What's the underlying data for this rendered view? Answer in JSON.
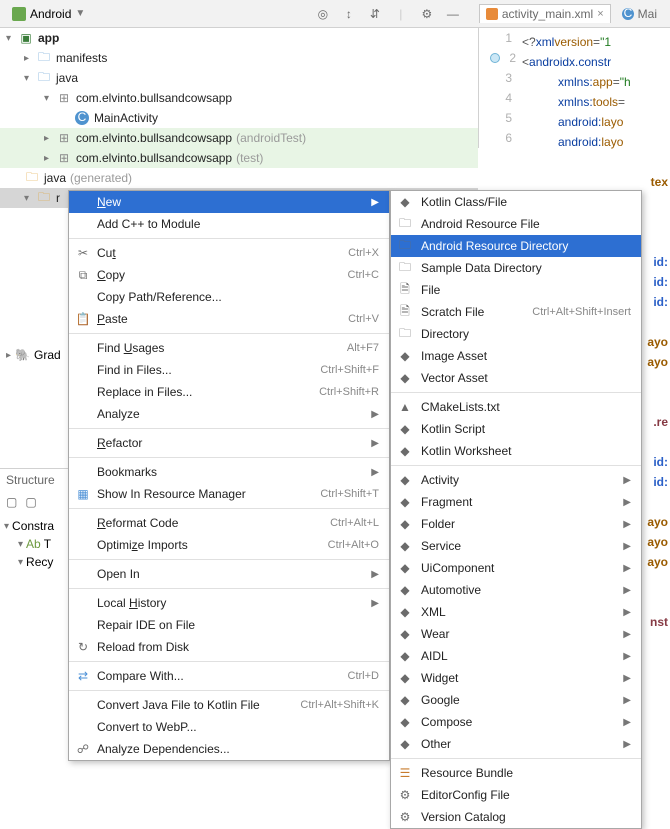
{
  "topbar": {
    "project_label": "Android",
    "tabs": [
      {
        "label": "activity_main.xml",
        "active": true
      },
      {
        "label": "Mai",
        "active": false
      }
    ]
  },
  "tree": {
    "app": "app",
    "manifests": "manifests",
    "java": "java",
    "pkg_main": "com.elvinto.bullsandcowsapp",
    "main_activity": "MainActivity",
    "pkg_android_test": "com.elvinto.bullsandcowsapp",
    "pkg_android_test_suffix": "(androidTest)",
    "pkg_test": "com.elvinto.bullsandcowsapp",
    "pkg_test_suffix": "(test)",
    "java_gen": "java",
    "java_gen_suffix": "(generated)",
    "res": "r",
    "grad": "Grad"
  },
  "structure": {
    "title": "Structure",
    "items": [
      "Constra",
      "T",
      "Recy"
    ]
  },
  "gutter": [
    1,
    2,
    3,
    4,
    5,
    6
  ],
  "code": [
    {
      "pre": "<?",
      "tag": "xml",
      "attr": " version",
      "eq": "=",
      "val": "\"1"
    },
    {
      "pre": "<",
      "tag": "androidx.constr"
    },
    {
      "attr": "xmlns:",
      "tag": "app",
      "eq": "=",
      "val": "\"h"
    },
    {
      "attr": "xmlns:",
      "tag": "tools",
      "eq": "="
    },
    {
      "attr": "android:",
      "tag": "layo"
    },
    {
      "attr": "android:",
      "tag": "layo"
    },
    {
      "tag2": "tex"
    },
    {
      "idv": "id:"
    },
    {
      "idv": "id:"
    },
    {
      "idv": "id:"
    },
    {
      "tag2": "ayo"
    },
    {
      "tag2": "ayo"
    },
    {
      "refc": ".re"
    },
    {
      "idv": "id:"
    },
    {
      "idv": "id:"
    },
    {
      "tag2": "ayo"
    },
    {
      "tag2": "ayo"
    },
    {
      "tag2": "ayo"
    },
    {
      "refc": "nst"
    }
  ],
  "menu1": [
    {
      "label": "<u>N</u>ew",
      "type": "sel",
      "sub": true
    },
    {
      "label": "Add C++ to Module",
      "type": "item"
    },
    {
      "type": "sep"
    },
    {
      "label": "Cu<u>t</u>",
      "sc": "Ctrl+X",
      "icon": "cut"
    },
    {
      "label": "<u>C</u>opy",
      "sc": "Ctrl+C",
      "icon": "copy"
    },
    {
      "label": "Copy Path/Reference..."
    },
    {
      "label": "<u>P</u>aste",
      "sc": "Ctrl+V",
      "icon": "paste"
    },
    {
      "type": "sep"
    },
    {
      "label": "Find <u>U</u>sages",
      "sc": "Alt+F7"
    },
    {
      "label": "Find in Files...",
      "sc": "Ctrl+Shift+F"
    },
    {
      "label": "Replace in Files...",
      "sc": "Ctrl+Shift+R"
    },
    {
      "label": "Analyze",
      "sub": true
    },
    {
      "type": "sep"
    },
    {
      "label": "<u>R</u>efactor",
      "sub": true
    },
    {
      "type": "sep"
    },
    {
      "label": "Bookmarks",
      "sub": true
    },
    {
      "label": "Show In Resource Manager",
      "sc": "Ctrl+Shift+T",
      "icon": "res"
    },
    {
      "type": "sep"
    },
    {
      "label": "<u>R</u>eformat Code",
      "sc": "Ctrl+Alt+L"
    },
    {
      "label": "Optimi<u>z</u>e Imports",
      "sc": "Ctrl+Alt+O"
    },
    {
      "type": "sep"
    },
    {
      "label": "Open In",
      "sub": true
    },
    {
      "type": "sep"
    },
    {
      "label": "Local <u>H</u>istory",
      "sub": true
    },
    {
      "label": "Repair IDE on File"
    },
    {
      "label": "Reload from Disk",
      "icon": "reload"
    },
    {
      "type": "sep"
    },
    {
      "label": "Compare With...",
      "sc": "Ctrl+D",
      "icon": "compare"
    },
    {
      "type": "sep"
    },
    {
      "label": "Convert Java File to Kotlin File",
      "sc": "Ctrl+Alt+Shift+K"
    },
    {
      "label": "Convert to WebP..."
    },
    {
      "label": "Analyze Dependencies...",
      "icon": "deps"
    }
  ],
  "menu2": [
    {
      "label": "Kotlin Class/File",
      "icon": "kt"
    },
    {
      "label": "Android Resource File",
      "icon": "folder"
    },
    {
      "label": "Android Resource Directory",
      "icon": "folder",
      "sel": true
    },
    {
      "label": "Sample Data Directory",
      "icon": "folder"
    },
    {
      "label": "File",
      "icon": "file"
    },
    {
      "label": "Scratch File",
      "sc": "Ctrl+Alt+Shift+Insert",
      "icon": "file"
    },
    {
      "label": "Directory",
      "icon": "folder"
    },
    {
      "label": "Image Asset",
      "icon": "and"
    },
    {
      "label": "Vector Asset",
      "icon": "and"
    },
    {
      "type": "sep"
    },
    {
      "label": "CMakeLists.txt",
      "icon": "cmake"
    },
    {
      "label": "Kotlin Script",
      "icon": "kt"
    },
    {
      "label": "Kotlin Worksheet",
      "icon": "kt"
    },
    {
      "type": "sep"
    },
    {
      "label": "Activity",
      "icon": "and",
      "sub": true
    },
    {
      "label": "Fragment",
      "icon": "and",
      "sub": true
    },
    {
      "label": "Folder",
      "icon": "and",
      "sub": true
    },
    {
      "label": "Service",
      "icon": "and",
      "sub": true
    },
    {
      "label": "UiComponent",
      "icon": "and",
      "sub": true
    },
    {
      "label": "Automotive",
      "icon": "and",
      "sub": true
    },
    {
      "label": "XML",
      "icon": "and",
      "sub": true
    },
    {
      "label": "Wear",
      "icon": "and",
      "sub": true
    },
    {
      "label": "AIDL",
      "icon": "and",
      "sub": true
    },
    {
      "label": "Widget",
      "icon": "and",
      "sub": true
    },
    {
      "label": "Google",
      "icon": "and",
      "sub": true
    },
    {
      "label": "Compose",
      "icon": "and",
      "sub": true
    },
    {
      "label": "Other",
      "icon": "and",
      "sub": true
    },
    {
      "type": "sep"
    },
    {
      "label": "Resource Bundle",
      "icon": "bundle"
    },
    {
      "label": "EditorConfig File",
      "icon": "cfg"
    },
    {
      "label": "Version Catalog",
      "icon": "cfg"
    }
  ]
}
